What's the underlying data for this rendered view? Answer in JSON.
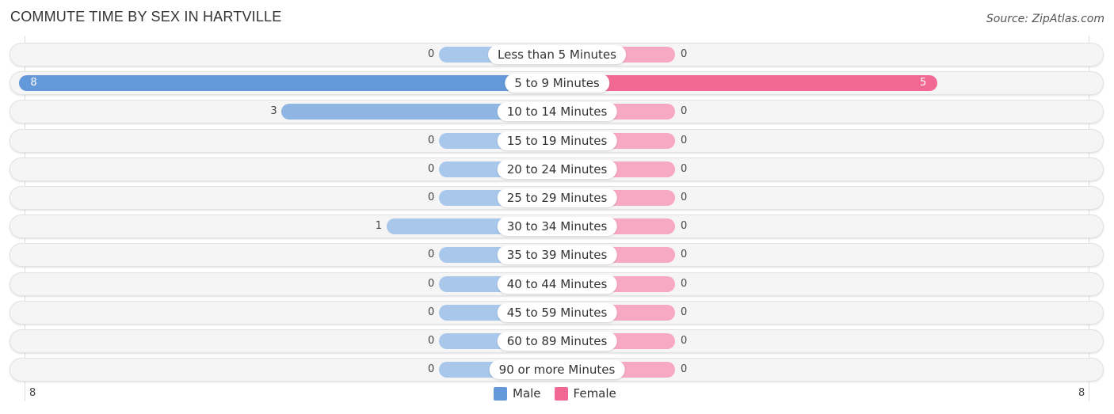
{
  "title": "COMMUTE TIME BY SEX IN HARTVILLE",
  "source": "Source: ZipAtlas.com",
  "colors": {
    "male": "#6399d8",
    "female": "#f06893",
    "male_light": "#a9c7ea",
    "female_light": "#f7a8c2"
  },
  "chart_data": {
    "type": "bar",
    "orientation": "horizontal-diverging",
    "title": "COMMUTE TIME BY SEX IN HARTVILLE",
    "categories": [
      "Less than 5 Minutes",
      "5 to 9 Minutes",
      "10 to 14 Minutes",
      "15 to 19 Minutes",
      "20 to 24 Minutes",
      "25 to 29 Minutes",
      "30 to 34 Minutes",
      "35 to 39 Minutes",
      "40 to 44 Minutes",
      "45 to 59 Minutes",
      "60 to 89 Minutes",
      "90 or more Minutes"
    ],
    "series": [
      {
        "name": "Male",
        "values": [
          0,
          8,
          3,
          0,
          0,
          0,
          1,
          0,
          0,
          0,
          0,
          0
        ]
      },
      {
        "name": "Female",
        "values": [
          0,
          5,
          0,
          0,
          0,
          0,
          0,
          0,
          0,
          0,
          0,
          0
        ]
      }
    ],
    "axis": {
      "left_label": "8",
      "right_label": "8",
      "max": 8
    },
    "legend": {
      "position": "bottom-center",
      "entries": [
        "Male",
        "Female"
      ]
    }
  }
}
